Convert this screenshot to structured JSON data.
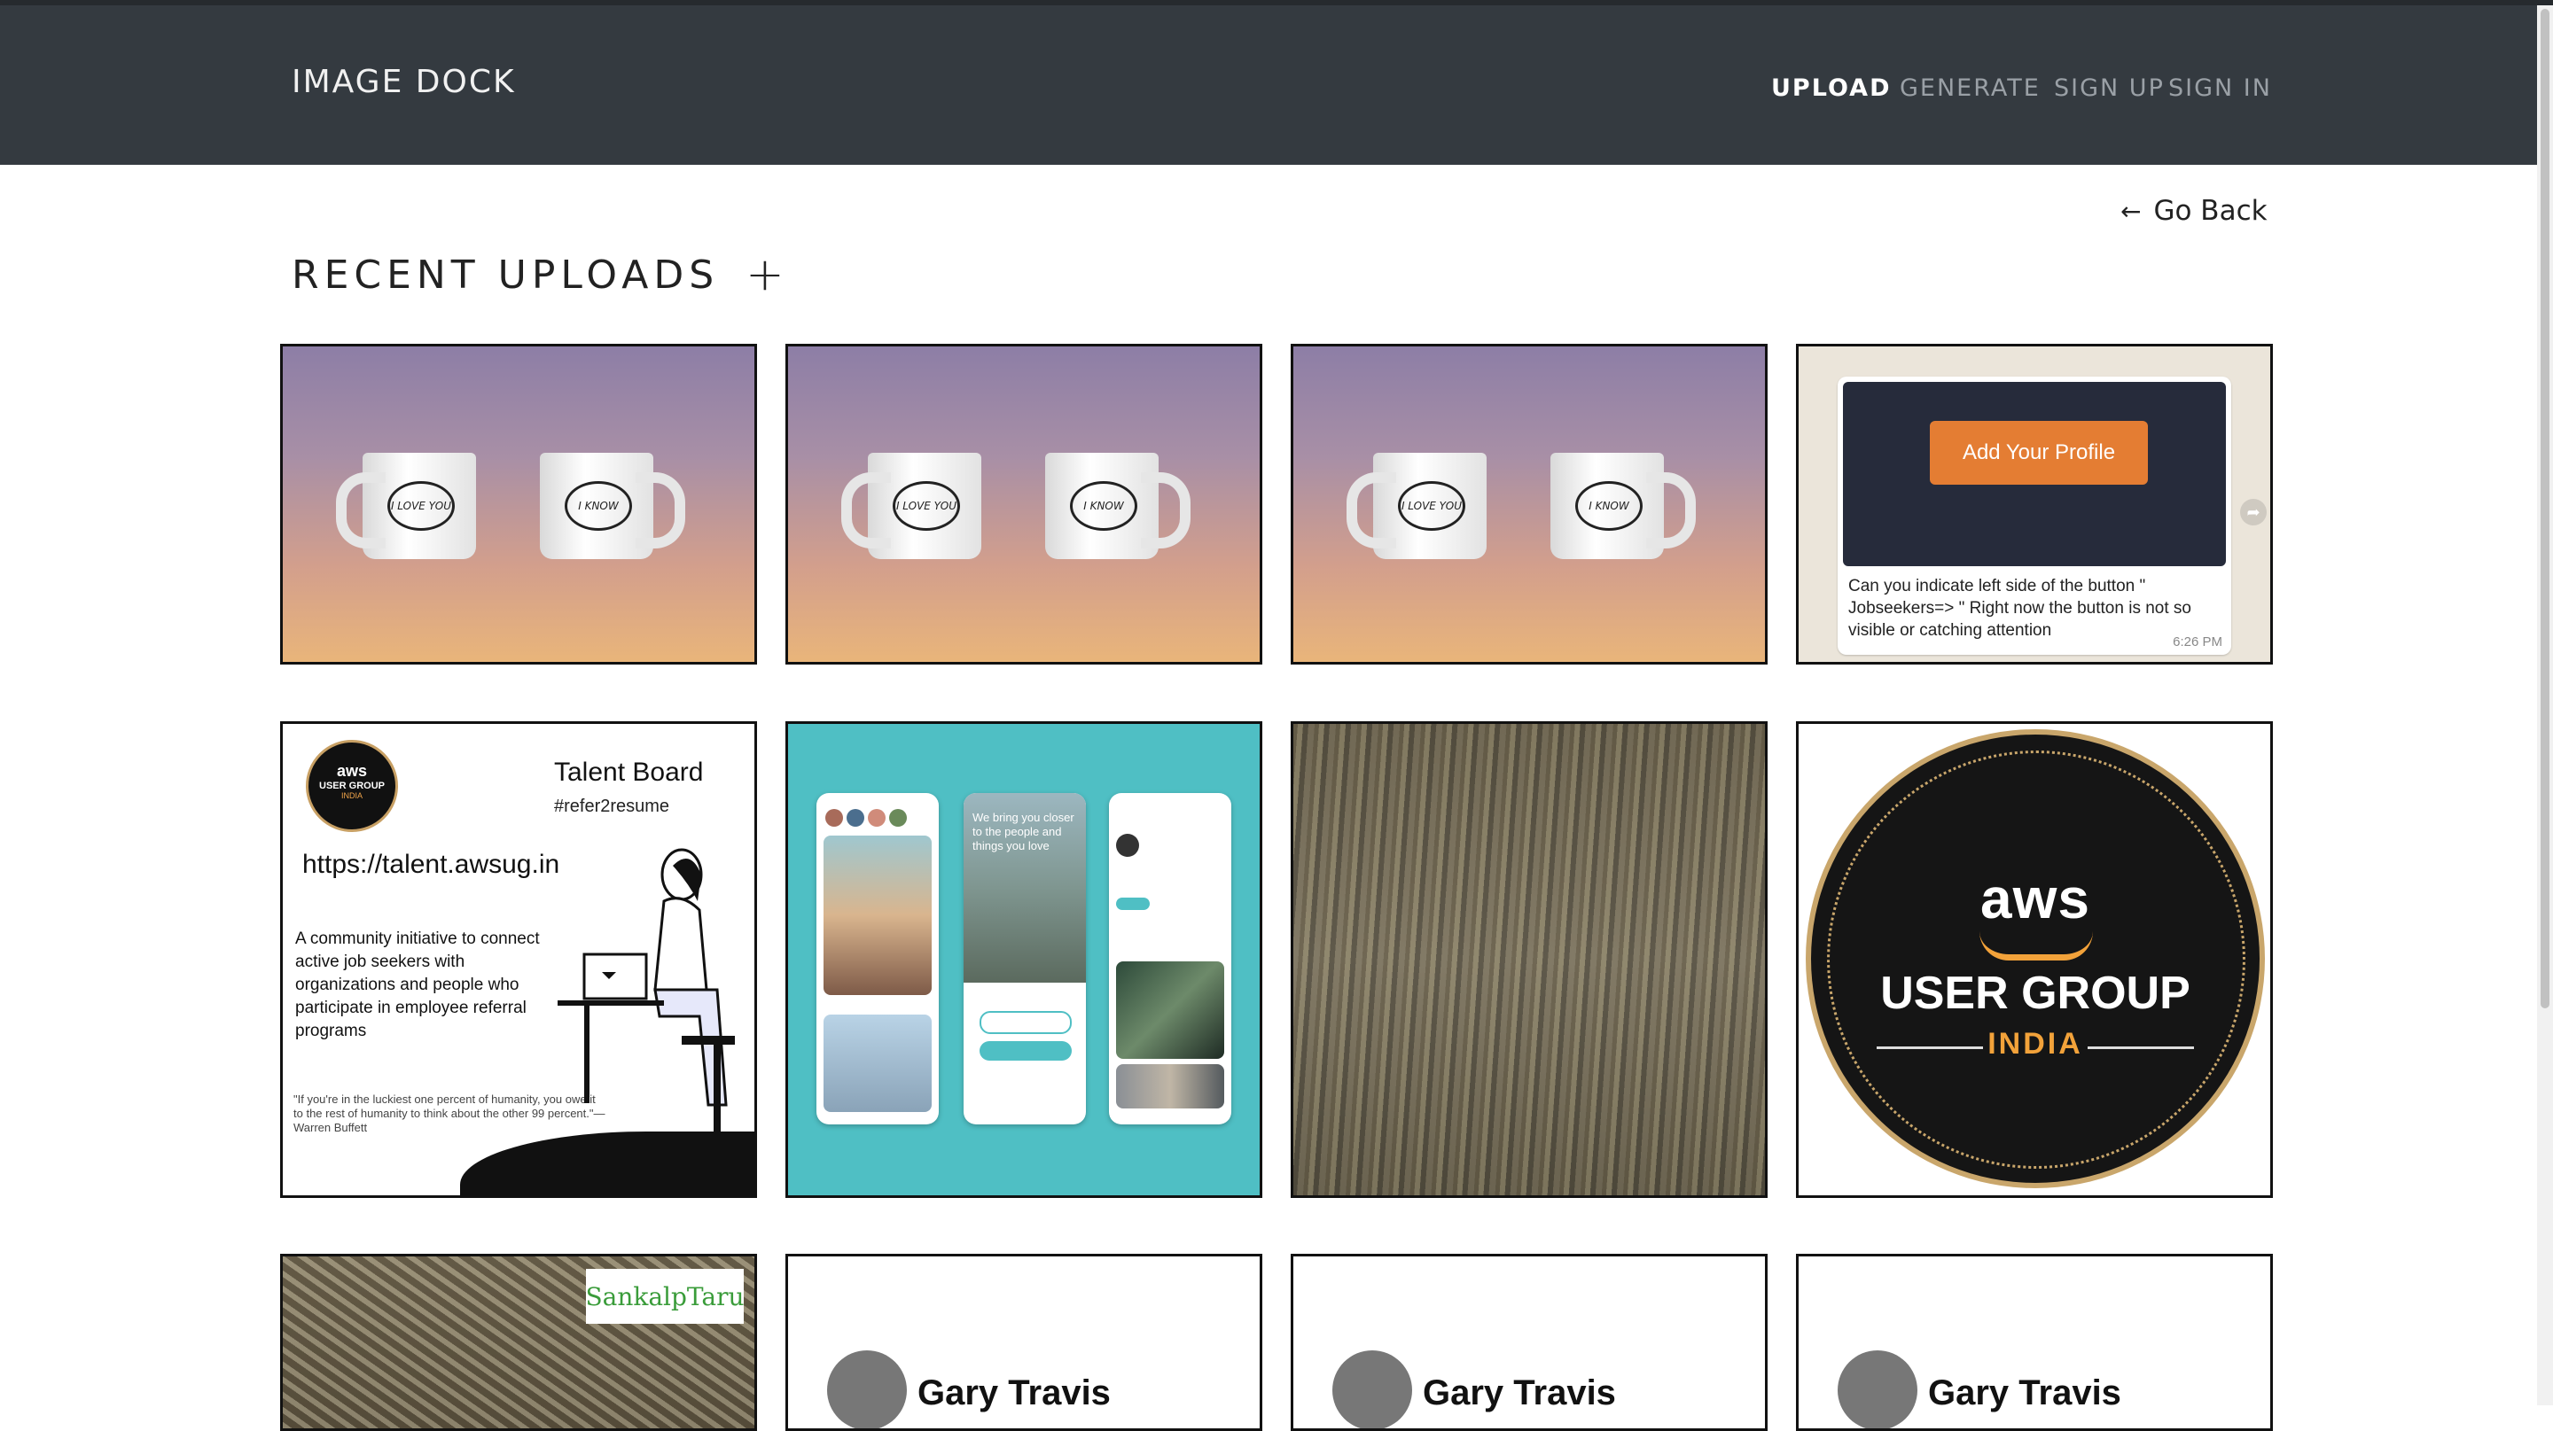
{
  "navbar": {
    "brand": "IMAGE DOCK",
    "links": {
      "upload": "UPLOAD",
      "generate": "GENERATE",
      "sign_up": "SIGN UP",
      "sign_in": "SIGN IN"
    },
    "active": "UPLOAD"
  },
  "go_back": {
    "icon": "arrow-left-icon",
    "label": "Go Back"
  },
  "section": {
    "title": "RECENT UPLOADS",
    "add_icon": "plus-icon"
  },
  "tiles": {
    "mug1": {
      "left_text": "I LOVE YOU",
      "right_text": "I KNOW"
    },
    "mug2": {
      "left_text": "I LOVE YOU",
      "right_text": "I KNOW"
    },
    "mug3": {
      "left_text": "I LOVE YOU",
      "right_text": "I KNOW"
    },
    "chat": {
      "button": "Add Your Profile",
      "message": "Can you indicate left side of the button \" Jobseekers=> \" Right now the button is not so visible or catching attention",
      "time": "6:26 PM"
    },
    "talent": {
      "logo_aws": "aws",
      "logo_group": "USER GROUP",
      "logo_india": "INDIA",
      "title": "Talent Board",
      "tag": "#refer2resume",
      "url": "https://talent.awsug.in",
      "description": "A community initiative to connect active job seekers with organizations and people who participate in employee referral programs",
      "quote": "\"If you're in the luckiest one percent of humanity, you owe it to the rest of humanity to think about the other 99 percent.\"— Warren Buffett"
    },
    "app": {
      "tagline": "We bring you closer to the people and things you love"
    },
    "aws_badge": {
      "aws": "aws",
      "group": "USER GROUP",
      "india": "INDIA"
    },
    "sankalp": {
      "logo": "SankalpTaru"
    },
    "gary1": {
      "name": "Gary Travis"
    },
    "gary2": {
      "name": "Gary Travis"
    },
    "gary3": {
      "name": "Gary Travis"
    }
  },
  "colors": {
    "navbar": "#343a40",
    "accent_button": "#e47d33",
    "teal": "#4fbfc4",
    "aws_orange": "#f2a23a"
  }
}
